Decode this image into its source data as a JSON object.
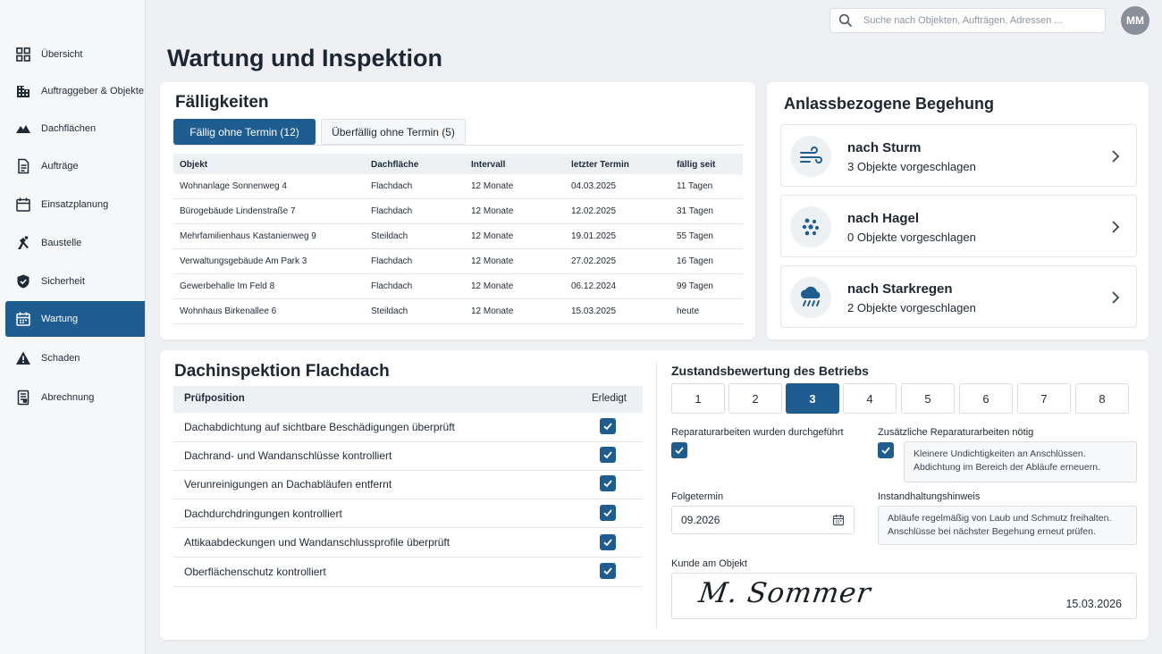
{
  "nav": [
    {
      "label": "Übersicht",
      "icon": "dashboard-grid-icon"
    },
    {
      "label": "Auftraggeber & Objekte",
      "icon": "building-icon"
    },
    {
      "label": "Dachflächen",
      "icon": "roof-icon"
    },
    {
      "label": "Aufträge",
      "icon": "document-icon"
    },
    {
      "label": "Einsatzplanung",
      "icon": "calendar-icon"
    },
    {
      "label": "Baustelle",
      "icon": "construction-worker-icon"
    },
    {
      "label": "Sicherheit",
      "icon": "shield-check-icon"
    },
    {
      "label": "Wartung",
      "icon": "maintenance-calendar-icon",
      "active": true
    },
    {
      "label": "Schaden",
      "icon": "warning-triangle-icon"
    },
    {
      "label": "Abrechnung",
      "icon": "invoice-icon"
    }
  ],
  "header": {
    "search_placeholder": "Suche nach Objekten, Aufträgen, Adressen ...",
    "avatar_initials": "MM"
  },
  "page_title": "Wartung und Inspektion",
  "faelligkeiten": {
    "title": "Fälligkeiten",
    "tabs": [
      {
        "label": "Fällig ohne Termin (12)",
        "active": true
      },
      {
        "label": "Überfällig ohne Termin (5)",
        "active": false
      }
    ],
    "columns": [
      "Objekt",
      "Dachfläche",
      "Intervall",
      "letzter Termin",
      "fällig seit"
    ],
    "rows": [
      [
        "Wohnanlage Sonnenweg 4",
        "Flachdach",
        "12 Monate",
        "04.03.2025",
        "11 Tagen"
      ],
      [
        "Bürogebäude Lindenstraße 7",
        "Flachdach",
        "12 Monate",
        "12.02.2025",
        "31 Tagen"
      ],
      [
        "Mehrfamilienhaus Kastanienweg 9",
        "Steildach",
        "12 Monate",
        "19.01.2025",
        "55 Tagen"
      ],
      [
        "Verwaltungsgebäude Am Park 3",
        "Flachdach",
        "12 Monate",
        "27.02.2025",
        "16 Tagen"
      ],
      [
        "Gewerbehalle Im Feld 8",
        "Flachdach",
        "12 Monate",
        "06.12.2024",
        "99 Tagen"
      ],
      [
        "Wohnhaus Birkenallee 6",
        "Steildach",
        "12 Monate",
        "15.03.2025",
        "heute"
      ]
    ]
  },
  "anlass": {
    "title": "Anlassbezogene Begehung",
    "items": [
      {
        "name": "nach Sturm",
        "count": "3 Objekte vorgeschlagen",
        "icon": "wind-icon"
      },
      {
        "name": "nach Hagel",
        "count": "0 Objekte vorgeschlagen",
        "icon": "hail-icon"
      },
      {
        "name": "nach Starkregen",
        "count": "2 Objekte vorgeschlagen",
        "icon": "heavy-rain-icon"
      }
    ]
  },
  "inspektion": {
    "title": "Dachinspektion Flachdach",
    "col_pruef": "Prüfposition",
    "col_erledigt": "Erledigt",
    "items": [
      {
        "label": "Dachabdichtung auf sichtbare Beschädigungen überprüft",
        "done": true
      },
      {
        "label": "Dachrand- und Wandanschlüsse kontrolliert",
        "done": true
      },
      {
        "label": "Verunreinigungen an Dachabläufen entfernt",
        "done": true
      },
      {
        "label": "Dachdurchdringungen kontrolliert",
        "done": true
      },
      {
        "label": "Attikaabdeckungen und Wandanschlussprofile überprüft",
        "done": true
      },
      {
        "label": "Oberflächenschutz kontrolliert",
        "done": true
      }
    ]
  },
  "bewertung": {
    "title": "Zustandsbewertung des Betriebs",
    "options": [
      "1",
      "2",
      "3",
      "4",
      "5",
      "6",
      "7",
      "8"
    ],
    "selected": "3",
    "rep_durchgefuehrt_label": "Reparaturarbeiten wurden durchgeführt",
    "rep_durchgefuehrt": true,
    "zusatz_label": "Zusätzliche Reparaturarbeiten nötig",
    "zusatz": true,
    "zusatz_text": "Kleinere Undichtigkeiten an Anschlüssen. Abdichtung im Bereich der Abläufe erneuern.",
    "folgetermin_label": "Folgetermin",
    "folgetermin": "09.2026",
    "hinweis_label": "Instandhaltungshinweis",
    "hinweis_text": "Abläufe regelmäßig von Laub und Schmutz freihalten. Anschlüsse bei nächster Begehung erneut prüfen.",
    "kunde_label": "Kunde am Objekt",
    "signature": "M. Sommer",
    "signature_date": "15.03.2026"
  }
}
